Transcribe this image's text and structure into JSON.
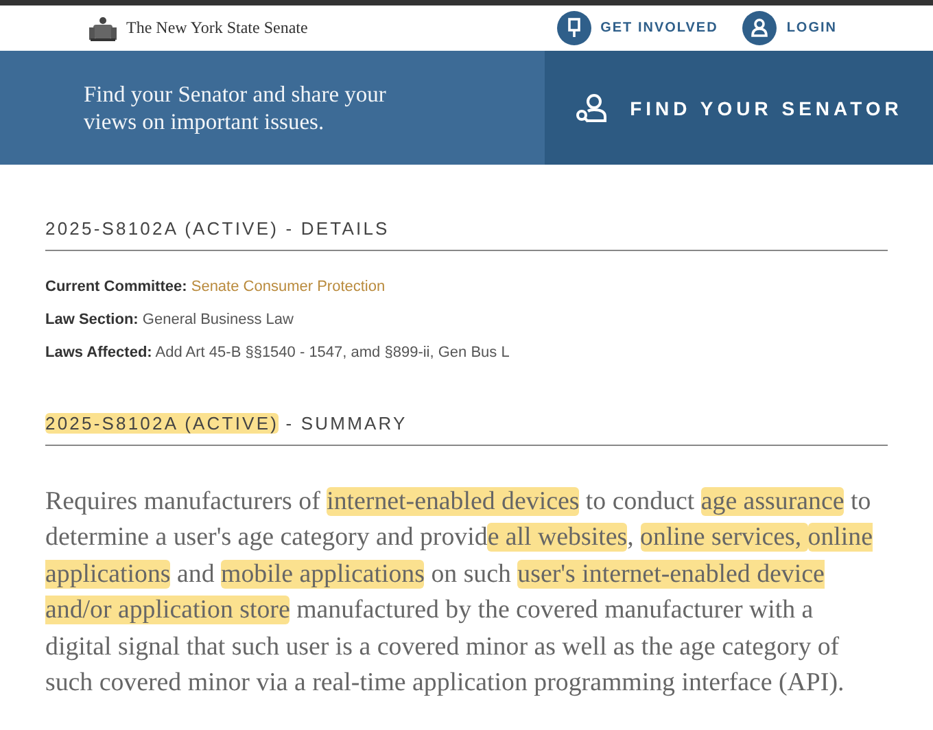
{
  "header": {
    "site_name": "The New York State Senate",
    "links": [
      {
        "label": "GET INVOLVED",
        "kind": "pin"
      },
      {
        "label": "LOGIN",
        "kind": "user"
      }
    ]
  },
  "banner": {
    "message": "Find your Senator and share your views on important issues.",
    "button": "FIND YOUR SENATOR"
  },
  "details": {
    "heading": [
      {
        "text": "2025-S8102A (ACTIVE)",
        "highlighted": false
      },
      {
        "text": " - DETAILS",
        "highlighted": false
      }
    ],
    "fields": [
      {
        "label": "Current Committee:",
        "value": "Senate Consumer Protection",
        "kind": "link"
      },
      {
        "label": "Law Section:",
        "value": "General Business Law",
        "kind": "text"
      },
      {
        "label": "Laws Affected:",
        "value": "Add Art 45-B §§1540 - 1547, amd §899-ii, Gen Bus L",
        "kind": "text"
      }
    ]
  },
  "summary": {
    "heading": [
      {
        "text": "2025-S8102A (ACTIVE)",
        "highlighted": true
      },
      {
        "text": " - SUMMARY",
        "highlighted": false
      }
    ],
    "text": [
      {
        "text": "Requires manufacturers of ",
        "highlighted": false
      },
      {
        "text": "internet-enabled devices",
        "highlighted": true
      },
      {
        "text": " to conduct ",
        "highlighted": false
      },
      {
        "text": "age assurance",
        "highlighted": true
      },
      {
        "text": " to determine a user's age category and provid",
        "highlighted": false
      },
      {
        "text": "e all websites",
        "highlighted": true
      },
      {
        "text": ", ",
        "highlighted": false
      },
      {
        "text": "online services, ",
        "highlighted": true
      },
      {
        "text": "online applications",
        "highlighted": true
      },
      {
        "text": " and ",
        "highlighted": false
      },
      {
        "text": "mobile applications",
        "highlighted": true
      },
      {
        "text": " on such ",
        "highlighted": false
      },
      {
        "text": "user's internet-enabled device and/or application store",
        "highlighted": true
      },
      {
        "text": " manufactured by the covered manufacturer with a digital signal that such user is a covered minor as well as the age category of such covered minor via a real-time application programming interface (API).",
        "highlighted": false
      }
    ]
  }
}
